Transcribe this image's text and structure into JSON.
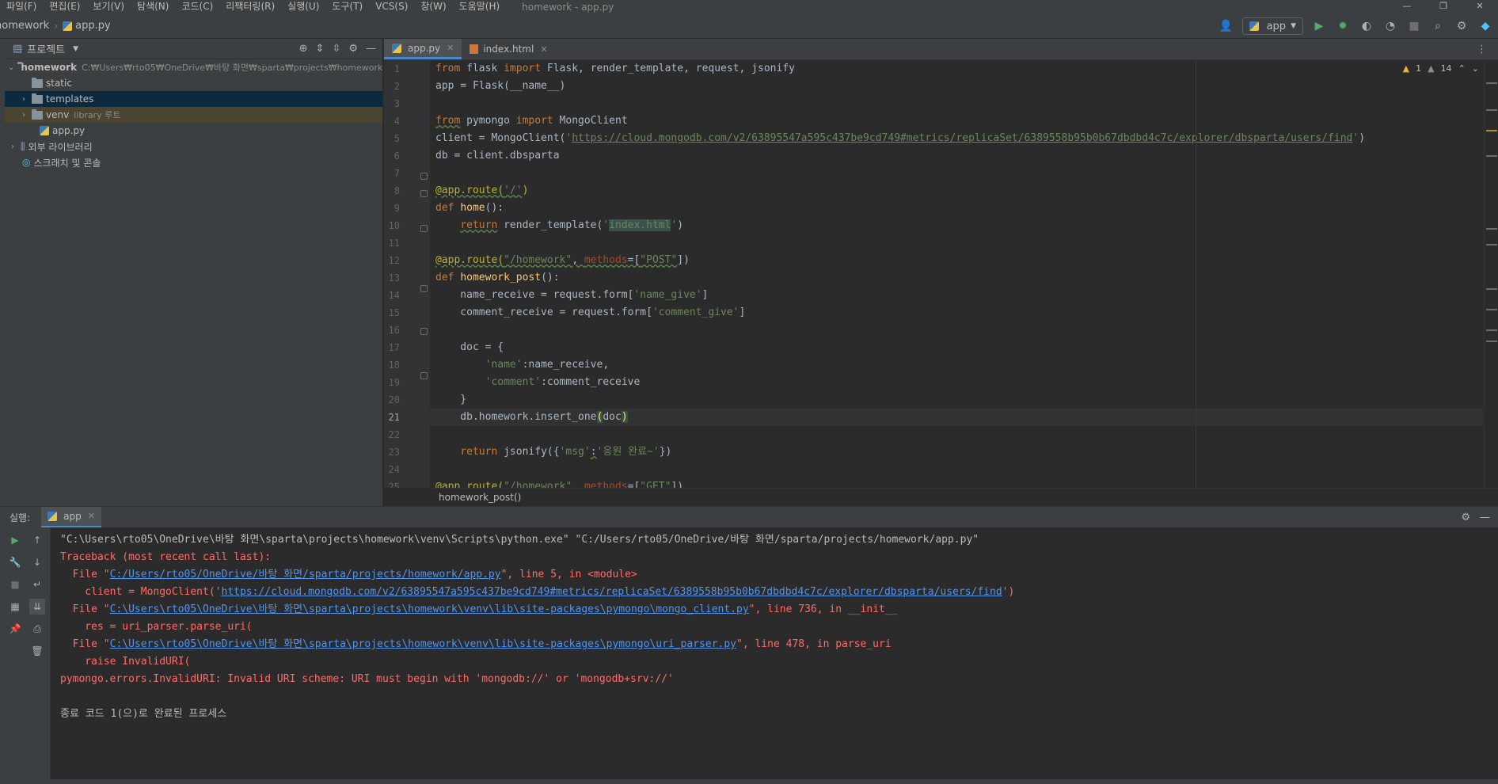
{
  "menubar": {
    "items": [
      "파일(F)",
      "편집(E)",
      "보기(V)",
      "탐색(N)",
      "코드(C)",
      "리팩터링(R)",
      "실행(U)",
      "도구(T)",
      "VCS(S)",
      "창(W)",
      "도움말(H)"
    ],
    "window_title": "homework - app.py"
  },
  "navbar": {
    "project": "homework",
    "file": "app.py",
    "run_config": "app"
  },
  "project": {
    "header": "프로젝트",
    "root": {
      "name": "homework",
      "path": "C:₩Users₩rto05₩OneDrive₩바탕 화면₩sparta₩projects₩homework"
    },
    "items": [
      {
        "name": "static"
      },
      {
        "name": "templates"
      },
      {
        "name": "venv",
        "hint": "library 루트"
      },
      {
        "name": "app.py"
      }
    ],
    "external_libs": "외부 라이브러리",
    "scratches": "스크래치 및 콘솔"
  },
  "editor": {
    "tabs": [
      {
        "label": "app.py",
        "active": true
      },
      {
        "label": "index.html",
        "active": false
      }
    ],
    "warnings": "1",
    "weak_warnings": "14",
    "current_line": 21,
    "line_numbers": [
      "1",
      "2",
      "3",
      "4",
      "5",
      "6",
      "7",
      "8",
      "9",
      "10",
      "11",
      "12",
      "13",
      "14",
      "15",
      "16",
      "17",
      "18",
      "19",
      "20",
      "21",
      "22",
      "23",
      "24",
      "25"
    ],
    "code": {
      "l1_a": "from",
      "l1_b": " flask ",
      "l1_c": "import",
      "l1_d": " Flask, render_template, request, jsonify",
      "l2": "app = Flask(__name__)",
      "l4_a": "from",
      "l4_b": " pymongo ",
      "l4_c": "import",
      "l4_d": " MongoClient",
      "l5_a": "client = MongoClient(",
      "l5_b": "'",
      "l5_url": "https://cloud.mongodb.com/v2/63895547a595c437be9cd749#metrics/replicaSet/6389558b95b0b67dbdbd4c7c/explorer/dbsparta/users/find",
      "l5_c": "'",
      "l5_d": ")",
      "l6": "db = client.dbsparta",
      "l8_a": "@app.route(",
      "l8_b": "'/'",
      "l8_c": ")",
      "l9_a": "def",
      "l9_b": " ",
      "l9_c": "home",
      "l9_d": "():",
      "l10_a": "    ",
      "l10_b": "return",
      "l10_c": " render_template(",
      "l10_d": "'",
      "l10_e": "index.html",
      "l10_f": "'",
      "l10_g": ")",
      "l12_a": "@app.route(",
      "l12_b": "\"/homework\"",
      "l12_c": ", ",
      "l12_d": "methods",
      "l12_e": "=[",
      "l12_f": "\"POST\"",
      "l12_g": "])",
      "l13_a": "def",
      "l13_b": " ",
      "l13_c": "homework_post",
      "l13_d": "():",
      "l14_a": "    name_receive = request.form[",
      "l14_b": "'name_give'",
      "l14_c": "]",
      "l15_a": "    comment_receive = request.form[",
      "l15_b": "'comment_give'",
      "l15_c": "]",
      "l17": "    doc = {",
      "l18_a": "        ",
      "l18_b": "'name'",
      "l18_c": ":name_receive,",
      "l19_a": "        ",
      "l19_b": "'comment'",
      "l19_c": ":comment_receive",
      "l20": "    }",
      "l21_a": "    db.homework.insert_one",
      "l21_b": "(",
      "l21_c": "doc",
      "l21_d": ")",
      "l23_a": "    ",
      "l23_b": "return",
      "l23_c": " jsonify({",
      "l23_d": "'msg'",
      "l23_e": ":",
      "l23_f": "'응원 완료~'",
      "l23_g": "})",
      "l25_a": "@app.route(",
      "l25_b": "\"/homework\"",
      "l25_c": ", ",
      "l25_d": "methods",
      "l25_e": "=[",
      "l25_f": "\"GET\"",
      "l25_g": "])"
    },
    "breadcrumb": "homework_post()"
  },
  "run": {
    "label": "실행:",
    "tab": "app",
    "console": {
      "cmd": "\"C:\\Users\\rto05\\OneDrive\\바탕 화면\\sparta\\projects\\homework\\venv\\Scripts\\python.exe\" \"C:/Users/rto05/OneDrive/바탕 화면/sparta/projects/homework/app.py\"",
      "tb_head": "Traceback (most recent call last):",
      "f1_a": "  File \"",
      "f1_link": "C:/Users/rto05/OneDrive/바탕 화면/sparta/projects/homework/app.py",
      "f1_b": "\", line 5, in <module>",
      "f1_code_a": "    client = MongoClient('",
      "f1_code_link": "https://cloud.mongodb.com/v2/63895547a595c437be9cd749#metrics/replicaSet/6389558b95b0b67dbdbd4c7c/explorer/dbsparta/users/find",
      "f1_code_b": "')",
      "f2_a": "  File \"",
      "f2_link": "C:\\Users\\rto05\\OneDrive\\바탕 화면\\sparta\\projects\\homework\\venv\\lib\\site-packages\\pymongo\\mongo_client.py",
      "f2_b": "\", line 736, in __init__",
      "f2_code": "    res = uri_parser.parse_uri(",
      "f3_a": "  File \"",
      "f3_link": "C:\\Users\\rto05\\OneDrive\\바탕 화면\\sparta\\projects\\homework\\venv\\lib\\site-packages\\pymongo\\uri_parser.py",
      "f3_b": "\", line 478, in parse_uri",
      "f3_code": "    raise InvalidURI(",
      "error": "pymongo.errors.InvalidURI: Invalid URI scheme: URI must begin with 'mongodb://' or 'mongodb+srv://'",
      "exit": "종료 코드 1(으)로 완료된 프로세스"
    }
  }
}
